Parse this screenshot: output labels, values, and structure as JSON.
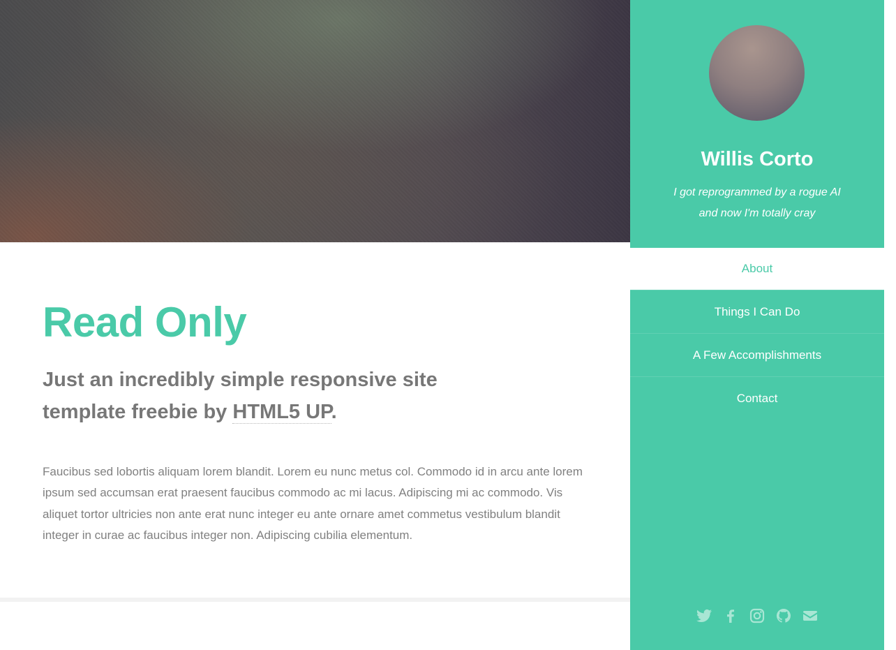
{
  "banner": {
    "image_description": ""
  },
  "intro": {
    "title": "Read Only",
    "subtitle_prefix": "Just an incredibly simple responsive site template freebie by ",
    "subtitle_link": "HTML5 UP",
    "subtitle_suffix": ".",
    "body": "Faucibus sed lobortis aliquam lorem blandit. Lorem eu nunc metus col. Commodo id in arcu ante lorem ipsum sed accumsan erat praesent faucibus commodo ac mi lacus. Adipiscing mi ac commodo. Vis aliquet tortor ultricies non ante erat nunc integer eu ante ornare amet commetus vestibulum blandit integer in curae ac faucibus integer non. Adipiscing cubilia elementum."
  },
  "sidebar": {
    "name": "Willis Corto",
    "tagline": "I got reprogrammed by a rogue AI and now I'm totally cray",
    "nav": [
      {
        "label": "About",
        "active": true
      },
      {
        "label": "Things I Can Do",
        "active": false
      },
      {
        "label": "A Few Accomplishments",
        "active": false
      },
      {
        "label": "Contact",
        "active": false
      }
    ],
    "social": [
      "twitter-icon",
      "facebook-icon",
      "instagram-icon",
      "github-icon",
      "email-icon"
    ]
  },
  "colors": {
    "accent": "#4acaa8",
    "text_heading": "#777777",
    "text_body": "#808080",
    "social_icon": "#a8e6d4"
  }
}
